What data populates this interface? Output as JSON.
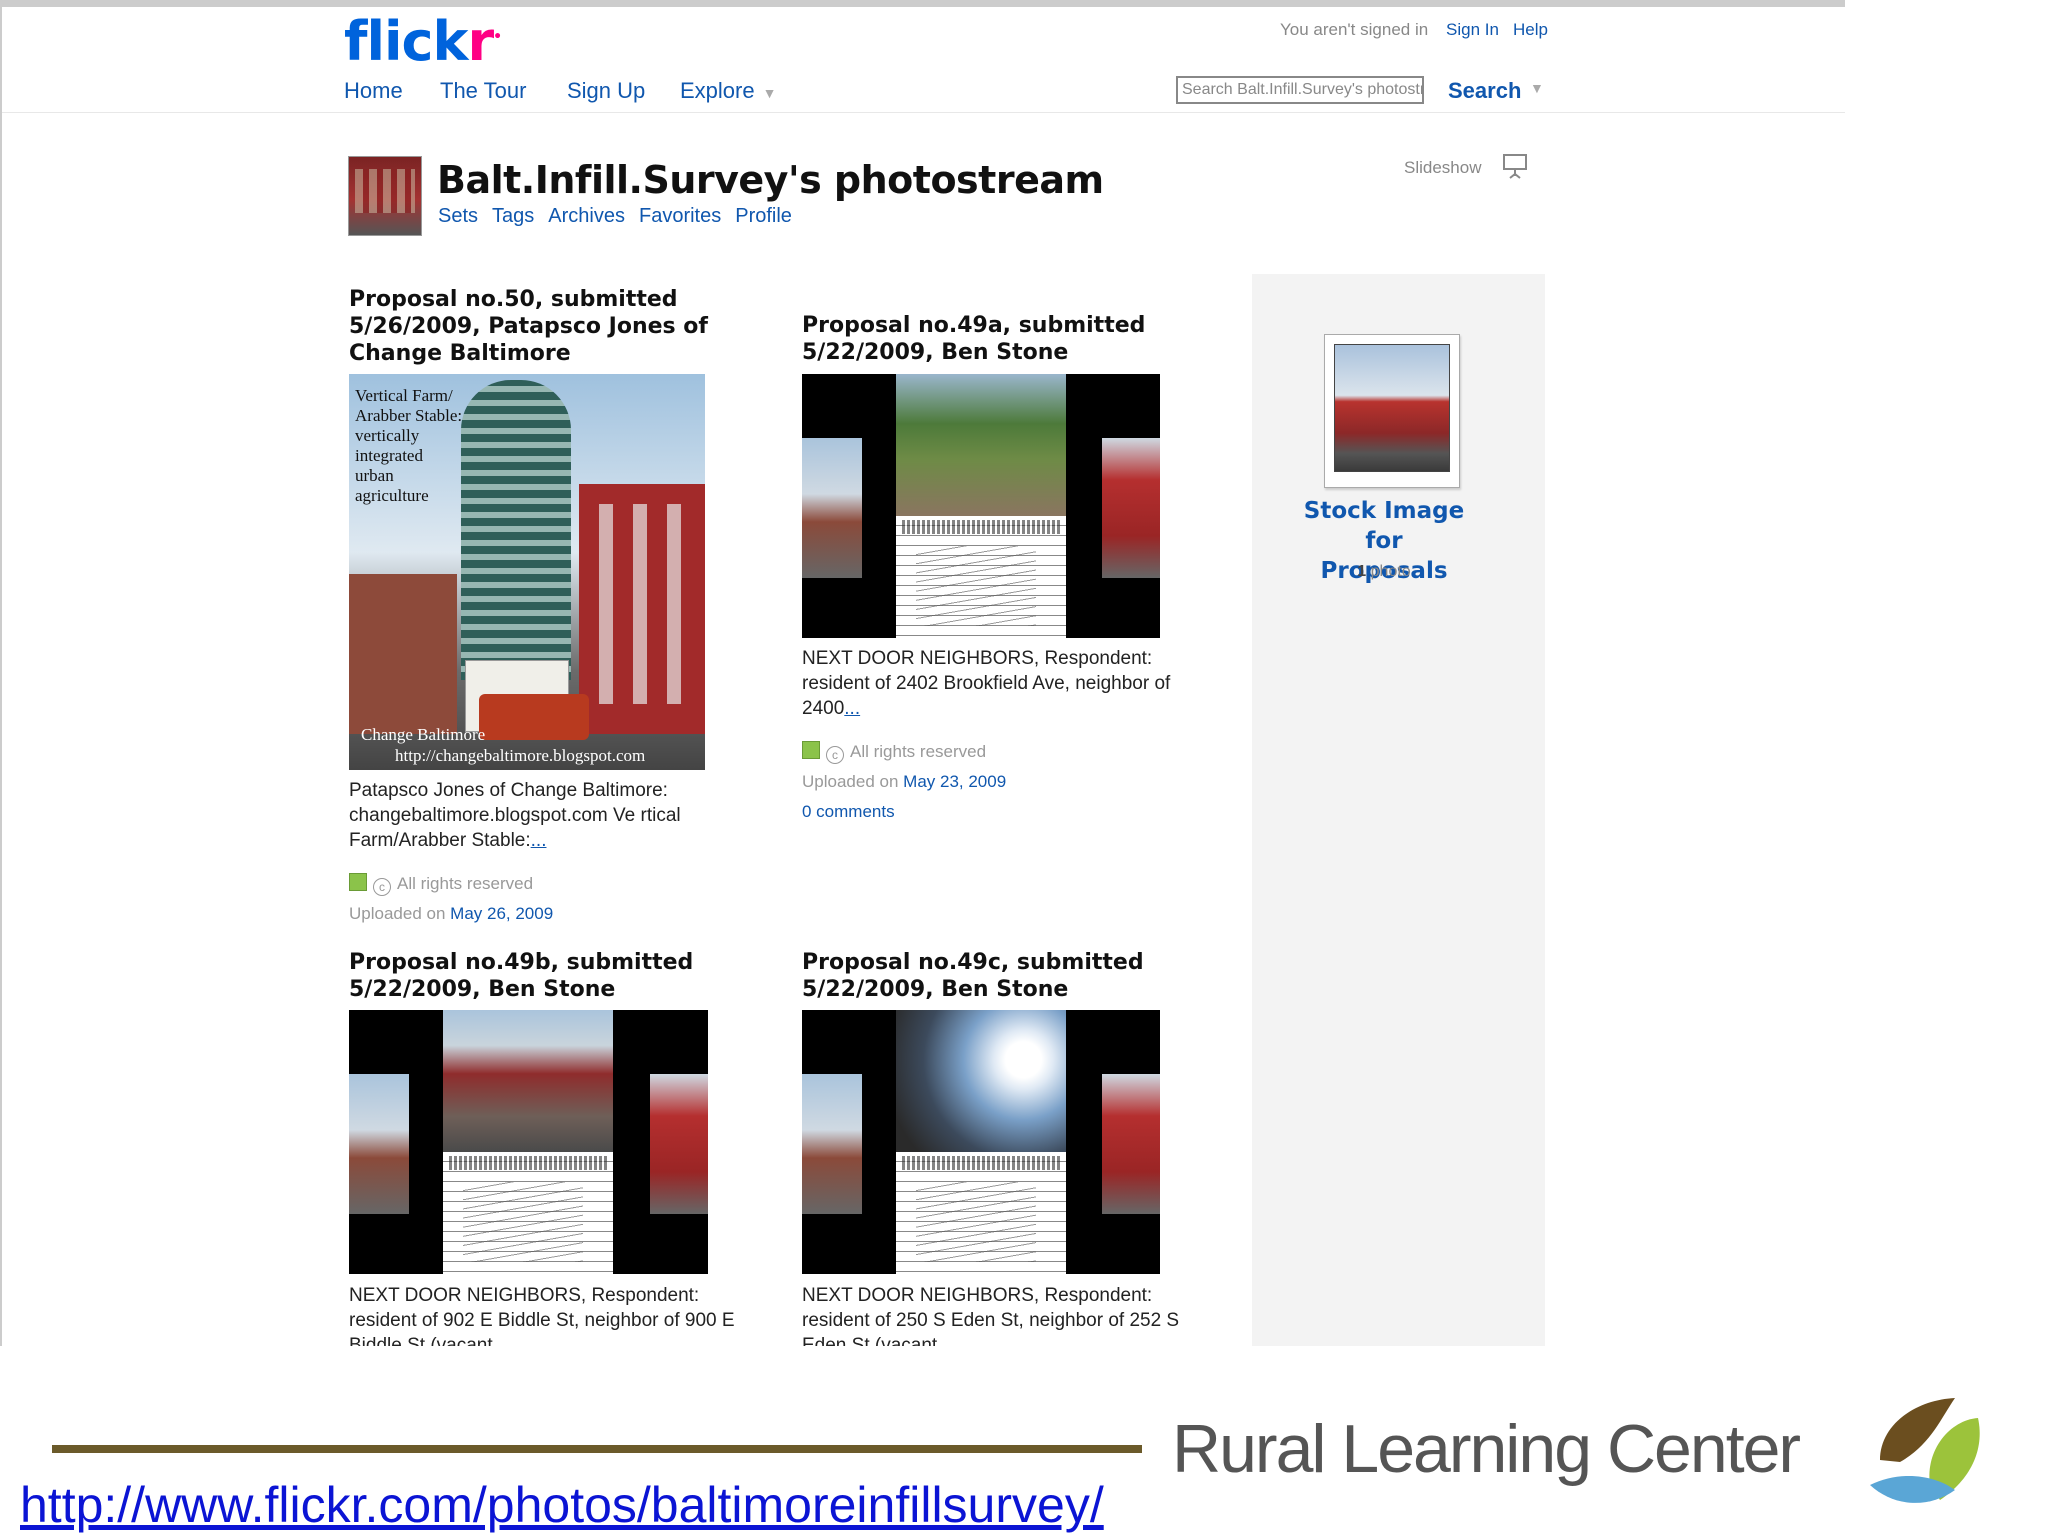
{
  "header": {
    "logo_part1": "flick",
    "logo_part2": "r",
    "nav": [
      "Home",
      "The Tour",
      "Sign Up",
      "Explore"
    ],
    "signed_status": "You aren't signed in",
    "sign_in": "Sign In",
    "help": "Help",
    "search_placeholder": "Search Balt.Infill.Survey's photostr",
    "search_button": "Search"
  },
  "profile": {
    "title": "Balt.Infill.Survey's photostream",
    "subnav": [
      "Sets",
      "Tags",
      "Archives",
      "Favorites",
      "Profile"
    ],
    "slideshow": "Slideshow"
  },
  "photos": [
    {
      "title": "Proposal no.50, submitted 5/26/2009, Patapsco Jones of Change Baltimore",
      "title_lines": [
        "Proposal no.50, submitted",
        "5/26/2009, Patapsco Jones of",
        "Change Baltimore"
      ],
      "overlay": [
        "Vertical Farm/",
        "Arabber Stable:",
        "vertically",
        "integrated",
        "urban",
        "agriculture"
      ],
      "overlay_footer": [
        "Change Baltimore",
        "http://changebaltimore.blogspot.com"
      ],
      "desc_lines": [
        "Patapsco Jones of Change Baltimore:",
        "changebaltimore.blogspot.com Ve rtical",
        "Farm/Arabber Stable:"
      ],
      "more": "...",
      "rights": "All rights reserved",
      "uploaded_prefix": "Uploaded on",
      "uploaded_date": "May 26, 2009"
    },
    {
      "title_lines": [
        "Proposal no.49a, submitted",
        "5/22/2009, Ben Stone"
      ],
      "desc_lines": [
        "NEXT DOOR NEIGHBORS, Respondent:",
        "resident of 2402 Brookfield Ave, neighbor of",
        "2400"
      ],
      "more": "...",
      "rights": "All rights reserved",
      "uploaded_prefix": "Uploaded on",
      "uploaded_date": "May 23, 2009",
      "comments": "0 comments"
    },
    {
      "title_lines": [
        "Proposal no.49b, submitted",
        "5/22/2009, Ben Stone"
      ],
      "desc_lines": [
        "NEXT DOOR NEIGHBORS, Respondent:",
        "resident of 902 E Biddle St, neighbor of 900 E",
        "Biddle St (vacant"
      ]
    },
    {
      "title_lines": [
        "Proposal no.49c, submitted",
        "5/22/2009, Ben Stone"
      ],
      "desc_lines": [
        "NEXT DOOR NEIGHBORS, Respondent:",
        "resident of 250 S Eden St, neighbor of 252 S",
        "Eden St (vacant"
      ]
    }
  ],
  "sidebar": {
    "set_title_lines": [
      "Stock Image for",
      "Proposals"
    ],
    "count_num": "1",
    "count_label": "photo"
  },
  "footer": {
    "url": "http://www.flickr.com/photos/baltimoreinfillsurvey/",
    "org": "Rural Learning Center"
  },
  "colors": {
    "link": "#1057ae",
    "logo_blue": "#0063dc",
    "logo_pink": "#ff0084",
    "url_blue": "#0b14d4",
    "footer_rule": "#6b5a2a"
  }
}
